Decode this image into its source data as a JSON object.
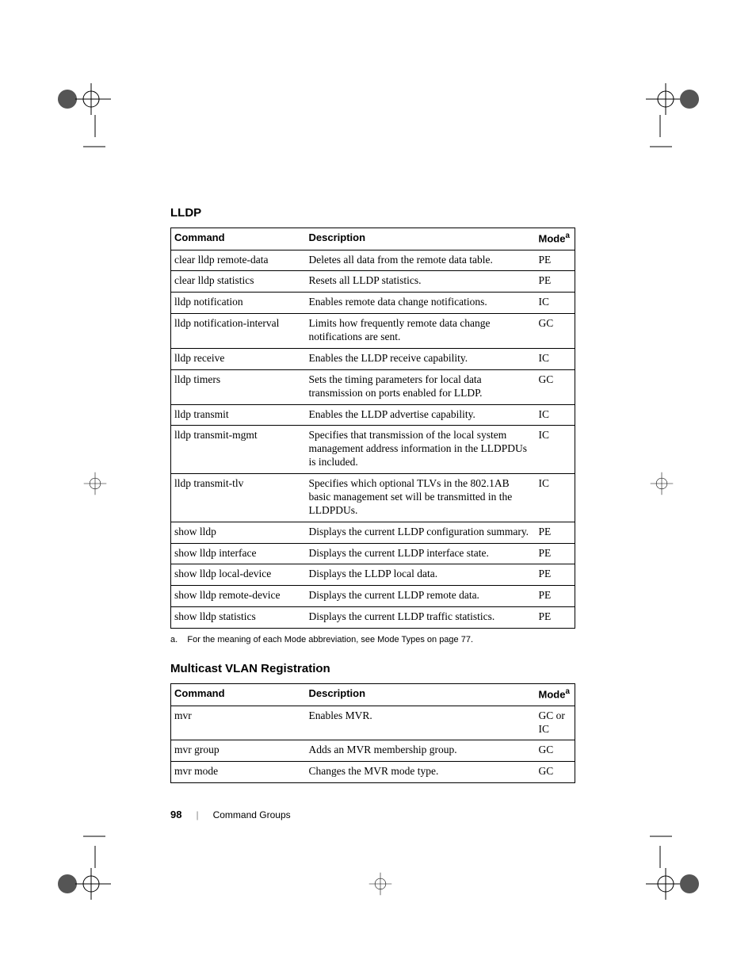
{
  "section1": {
    "title": "LLDP",
    "headers": {
      "c1": "Command",
      "c2": "Description",
      "c3": "Mode"
    },
    "super": "a",
    "rows": [
      {
        "cmd": "clear lldp remote-data",
        "desc": "Deletes all data from the remote data table.",
        "mode": "PE"
      },
      {
        "cmd": "clear lldp statistics",
        "desc": "Resets all LLDP statistics.",
        "mode": "PE"
      },
      {
        "cmd": "lldp notification",
        "desc": "Enables remote data change notifications.",
        "mode": "IC"
      },
      {
        "cmd": "lldp notification-interval",
        "desc": "Limits how frequently remote data change notifications are sent.",
        "mode": "GC"
      },
      {
        "cmd": "lldp receive",
        "desc": "Enables the LLDP receive capability.",
        "mode": "IC"
      },
      {
        "cmd": "lldp timers",
        "desc": "Sets the timing parameters for local data transmission on ports enabled for LLDP.",
        "mode": "GC"
      },
      {
        "cmd": "lldp transmit",
        "desc": "Enables the LLDP advertise capability.",
        "mode": "IC"
      },
      {
        "cmd": "lldp transmit-mgmt",
        "desc": "Specifies that transmission of the local system management address information in the LLDPDUs is included.",
        "mode": "IC"
      },
      {
        "cmd": "lldp transmit-tlv",
        "desc": "Specifies which optional TLVs in the 802.1AB basic management set will be transmitted in the LLDPDUs.",
        "mode": "IC"
      },
      {
        "cmd": "show lldp",
        "desc": "Displays the current LLDP configuration summary.",
        "mode": "PE"
      },
      {
        "cmd": "show lldp interface",
        "desc": "Displays the current LLDP interface state.",
        "mode": "PE"
      },
      {
        "cmd": "show lldp local-device",
        "desc": "Displays the LLDP local data.",
        "mode": "PE"
      },
      {
        "cmd": "show lldp remote-device",
        "desc": "Displays the current LLDP remote data.",
        "mode": "PE"
      },
      {
        "cmd": "show lldp statistics",
        "desc": "Displays the current LLDP traffic statistics.",
        "mode": "PE"
      }
    ],
    "footnote_label": "a.",
    "footnote_text": "For the meaning of each Mode abbreviation, see Mode Types on page 77."
  },
  "section2": {
    "title": "Multicast VLAN Registration",
    "headers": {
      "c1": "Command",
      "c2": "Description",
      "c3": "Mode"
    },
    "super": "a",
    "rows": [
      {
        "cmd": "mvr",
        "desc": "Enables MVR.",
        "mode": "GC or IC"
      },
      {
        "cmd": "mvr group",
        "desc": "Adds an MVR membership group.",
        "mode": "GC"
      },
      {
        "cmd": "mvr mode",
        "desc": "Changes the MVR mode type.",
        "mode": "GC"
      }
    ]
  },
  "footer": {
    "page_number": "98",
    "separator": "|",
    "section_name": "Command Groups"
  }
}
